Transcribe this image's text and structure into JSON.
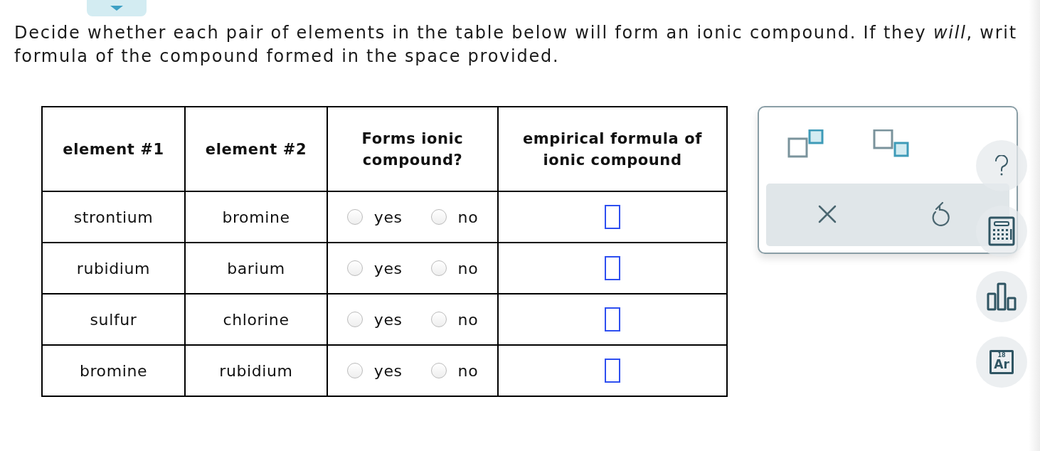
{
  "question": "Decide whether each pair of elements in the table below will form an ionic compound. If they *will*, writ",
  "question_line_2": "formula of the compound formed in the space provided.",
  "table": {
    "columns": [
      "element #1",
      "element #2",
      "Forms ionic compound?",
      "empirical formula of ionic compound"
    ],
    "rows": [
      {
        "element_1": "strontium",
        "element_2": "bromine",
        "options": [
          {
            "label": "yes",
            "selected": false
          },
          {
            "label": "no",
            "selected": false
          }
        ]
      },
      {
        "element_1": "rubidium",
        "element_2": "barium",
        "options": [
          {
            "label": "yes",
            "selected": false
          },
          {
            "label": "no",
            "selected": false
          }
        ]
      },
      {
        "element_1": "sulfur",
        "element_2": "chlorine",
        "options": [
          {
            "label": "yes",
            "selected": false
          },
          {
            "label": "no",
            "selected": false
          }
        ]
      },
      {
        "element_1": "bromine",
        "element_2": "rubidium",
        "options": [
          {
            "label": "yes",
            "selected": false
          },
          {
            "label": "no",
            "selected": false
          }
        ]
      }
    ]
  },
  "side_tools": [
    {
      "kind": "help"
    },
    {
      "kind": "calculator"
    },
    {
      "kind": "chart"
    },
    {
      "kind": "periodic",
      "number": "18",
      "symbol": "Ar"
    }
  ]
}
